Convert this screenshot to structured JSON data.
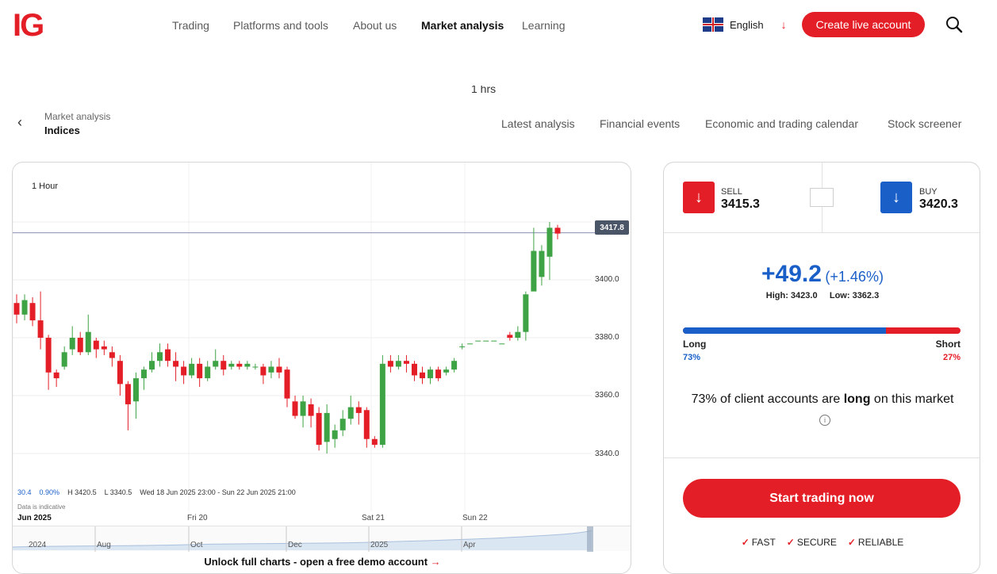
{
  "brand": {
    "logo": "IG",
    "accent": "#e41e26",
    "blue": "#1a5fc8"
  },
  "nav": {
    "items": [
      {
        "label": "Trading"
      },
      {
        "label": "Platforms and tools"
      },
      {
        "label": "About us"
      },
      {
        "label": "Market analysis"
      },
      {
        "label": "Learning"
      }
    ],
    "language": "English",
    "cta": "Create live account",
    "search_icon": "search-icon"
  },
  "subnav": {
    "breadcrumb_parent": "Market analysis",
    "breadcrumb_current": "Indices",
    "links": [
      {
        "label": "Latest analysis"
      },
      {
        "label": "Financial events"
      },
      {
        "label": "Economic and trading calendar"
      },
      {
        "label": "Stock screener"
      }
    ]
  },
  "partial_text": "1 hrs",
  "chart": {
    "interval": "1 Hour",
    "last_price": "3417.8",
    "y_ticks": [
      "3400.0",
      "3380.0",
      "3360.0",
      "3340.0"
    ],
    "stats": {
      "change": "30.4",
      "change_pct": "0.90%",
      "high": "H 3420.5",
      "low": "L 3340.5",
      "range": "Wed 18 Jun 2025 23:00 - Sun 22 Jun 2025 21:00",
      "disclaimer": "Data is indicative"
    },
    "x_labels": [
      "Jun 2025",
      "Fri 20",
      "Sat 21",
      "Sun 22"
    ],
    "navigator_labels": [
      "2024",
      "Aug",
      "Oct",
      "Dec",
      "2025",
      "Apr"
    ],
    "unlock_text": "Unlock full charts - open a free demo account",
    "unlock_arrow": "→"
  },
  "chart_data": {
    "type": "candlestick",
    "interval": "1 Hour",
    "ylim": [
      3334,
      3422
    ],
    "y_ticks": [
      3340,
      3360,
      3380,
      3400
    ],
    "candles": [
      [
        3392,
        3388,
        3395,
        3385
      ],
      [
        3388,
        3393,
        3395,
        3386
      ],
      [
        3392,
        3386,
        3394,
        3384
      ],
      [
        3386,
        3380,
        3396,
        3376
      ],
      [
        3380,
        3368,
        3381,
        3362
      ],
      [
        3368,
        3366,
        3369,
        3363
      ],
      [
        3370,
        3375,
        3377,
        3369
      ],
      [
        3376,
        3380,
        3384,
        3374
      ],
      [
        3380,
        3375,
        3382,
        3374
      ],
      [
        3375,
        3382,
        3388,
        3374
      ],
      [
        3379,
        3376,
        3380,
        3373
      ],
      [
        3377,
        3376,
        3379,
        3374
      ],
      [
        3375,
        3373,
        3377,
        3370
      ],
      [
        3372,
        3364,
        3374,
        3360
      ],
      [
        3364,
        3357,
        3365,
        3348
      ],
      [
        3358,
        3366,
        3368,
        3352
      ],
      [
        3366,
        3369,
        3370,
        3362
      ],
      [
        3369,
        3372,
        3375,
        3368
      ],
      [
        3372,
        3375,
        3378,
        3370
      ],
      [
        3376,
        3372,
        3378,
        3370
      ],
      [
        3372,
        3370,
        3375,
        3365
      ],
      [
        3370,
        3367,
        3372,
        3364
      ],
      [
        3367,
        3371,
        3373,
        3366
      ],
      [
        3371,
        3366,
        3373,
        3363
      ],
      [
        3366,
        3370,
        3372,
        3365
      ],
      [
        3370,
        3372,
        3376,
        3369
      ],
      [
        3372,
        3369,
        3374,
        3367
      ],
      [
        3370,
        3371,
        3372,
        3369
      ],
      [
        3371,
        3370,
        3372,
        3369
      ],
      [
        3370,
        3371,
        3372,
        3369
      ],
      [
        3370,
        3370,
        3371,
        3369
      ],
      [
        3370,
        3367,
        3371,
        3364
      ],
      [
        3368,
        3370,
        3372,
        3366
      ],
      [
        3370,
        3368,
        3373,
        3366
      ],
      [
        3369,
        3359,
        3370,
        3356
      ],
      [
        3358,
        3353,
        3360,
        3352
      ],
      [
        3353,
        3358,
        3360,
        3349
      ],
      [
        3357,
        3353,
        3359,
        3349
      ],
      [
        3354,
        3343,
        3356,
        3341
      ],
      [
        3344,
        3354,
        3357,
        3340
      ],
      [
        3345,
        3348,
        3350,
        3342
      ],
      [
        3348,
        3352,
        3355,
        3346
      ],
      [
        3352,
        3356,
        3360,
        3350
      ],
      [
        3356,
        3354,
        3358,
        3350
      ],
      [
        3355,
        3345,
        3356,
        3342
      ],
      [
        3345,
        3343,
        3346,
        3342
      ],
      [
        3343,
        3371,
        3374,
        3342
      ],
      [
        3372,
        3370,
        3374,
        3368
      ],
      [
        3370,
        3372,
        3374,
        3369
      ],
      [
        3372,
        3371,
        3374,
        3368
      ],
      [
        3371,
        3367,
        3372,
        3365
      ],
      [
        3368,
        3366,
        3370,
        3364
      ],
      [
        3366,
        3369,
        3370,
        3364
      ],
      [
        3369,
        3366,
        3370,
        3365
      ],
      [
        3368,
        3369,
        3370,
        3367
      ],
      [
        3369,
        3372,
        3373,
        3368
      ],
      [
        3377,
        3377,
        3378,
        3376
      ],
      [
        3378,
        3378,
        3378,
        3378
      ],
      [
        3379,
        3379,
        3379,
        3379
      ],
      [
        3379,
        3379,
        3379,
        3379
      ],
      [
        3379,
        3379,
        3379,
        3379
      ],
      [
        3378,
        3378,
        3378,
        3378
      ],
      [
        3381,
        3380,
        3382,
        3379
      ],
      [
        3380,
        3382,
        3384,
        3379
      ],
      [
        3382,
        3395,
        3396,
        3379
      ],
      [
        3396,
        3410,
        3418,
        3399
      ],
      [
        3401,
        3410,
        3412,
        3398
      ],
      [
        3408,
        3418,
        3420,
        3400
      ],
      [
        3418,
        3416,
        3419,
        3414
      ]
    ]
  },
  "trade": {
    "sell_label": "SELL",
    "sell_price": "3415.3",
    "buy_label": "BUY",
    "buy_price": "3420.3",
    "change": "+49.2",
    "change_pct": "(+1.46%)",
    "high": "High: 3423.0",
    "low": "Low: 3362.3",
    "long_label": "Long",
    "short_label": "Short",
    "long_pct": "73%",
    "short_pct": "27%",
    "long_share": 0.73,
    "sentence_pre": "73% of client accounts are",
    "sentence_bold": "long",
    "sentence_post": "on this market",
    "start_button": "Start trading now",
    "features": [
      {
        "label": "FAST"
      },
      {
        "label": "SECURE"
      },
      {
        "label": "RELIABLE"
      }
    ]
  }
}
